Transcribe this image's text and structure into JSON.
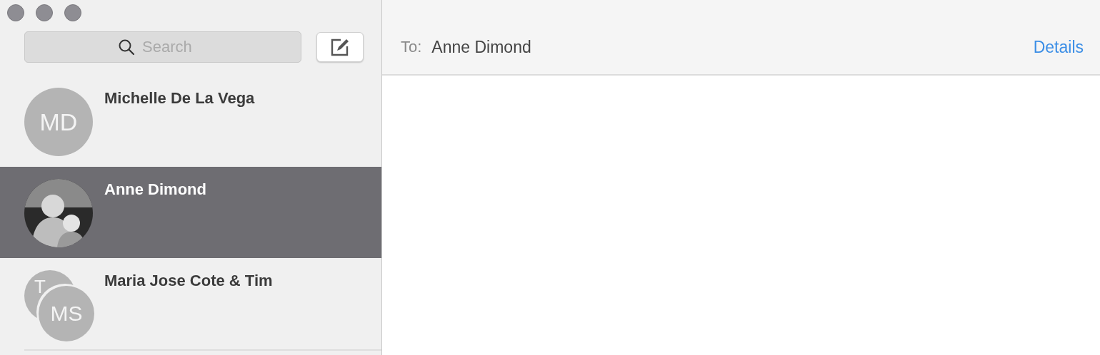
{
  "search": {
    "placeholder": "Search"
  },
  "conversations": [
    {
      "name": "Michelle De La Vega",
      "kind": "initials",
      "initials": [
        "MD"
      ],
      "selected": false
    },
    {
      "name": "Anne Dimond",
      "kind": "photo",
      "selected": true
    },
    {
      "name": "Maria Jose Cote & Tim",
      "kind": "group",
      "initials": [
        "T",
        "MS"
      ],
      "selected": false
    }
  ],
  "header": {
    "to_label": "To:",
    "recipient": "Anne Dimond",
    "details": "Details"
  }
}
